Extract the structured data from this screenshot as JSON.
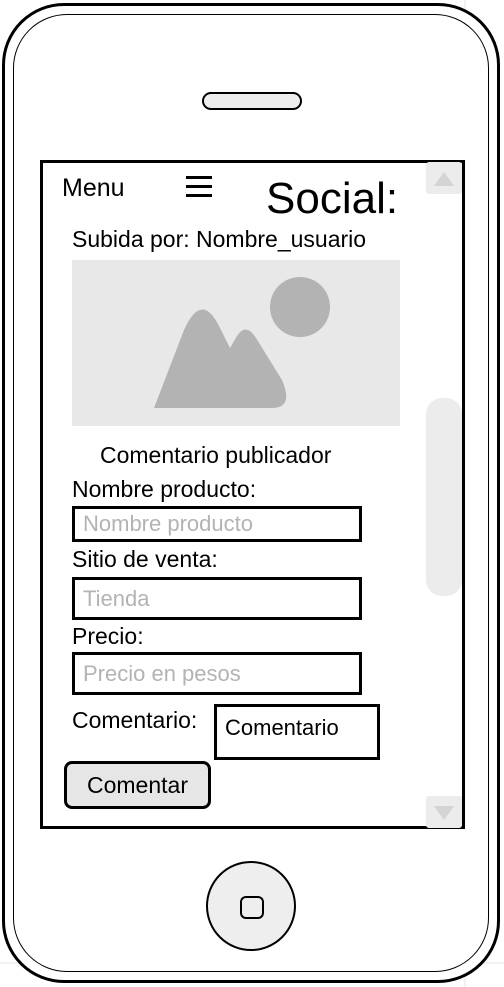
{
  "header": {
    "menu_label": "Menu",
    "menu_icon": "hamburger-icon",
    "app_title": "Social:"
  },
  "post": {
    "uploaded_by": "Subida por: Nombre_usuario",
    "image_icon": "image-placeholder-icon",
    "publisher_comment": "Comentario publicador"
  },
  "form": {
    "product_name_label": "Nombre producto:",
    "product_name_placeholder": "Nombre producto",
    "site_label": "Sitio de venta:",
    "site_placeholder": "Tienda",
    "price_label": "Precio:",
    "price_placeholder": "Precio en pesos",
    "comment_label": "Comentario:",
    "comment_value": "Comentario",
    "submit_label": "Comentar"
  },
  "colors": {
    "border": "#000000",
    "placeholder_bg": "#e8e8e8",
    "placeholder_shape": "#b3b3b3",
    "button_bg": "#e6e6e6",
    "scrollbar": "#ececec"
  }
}
